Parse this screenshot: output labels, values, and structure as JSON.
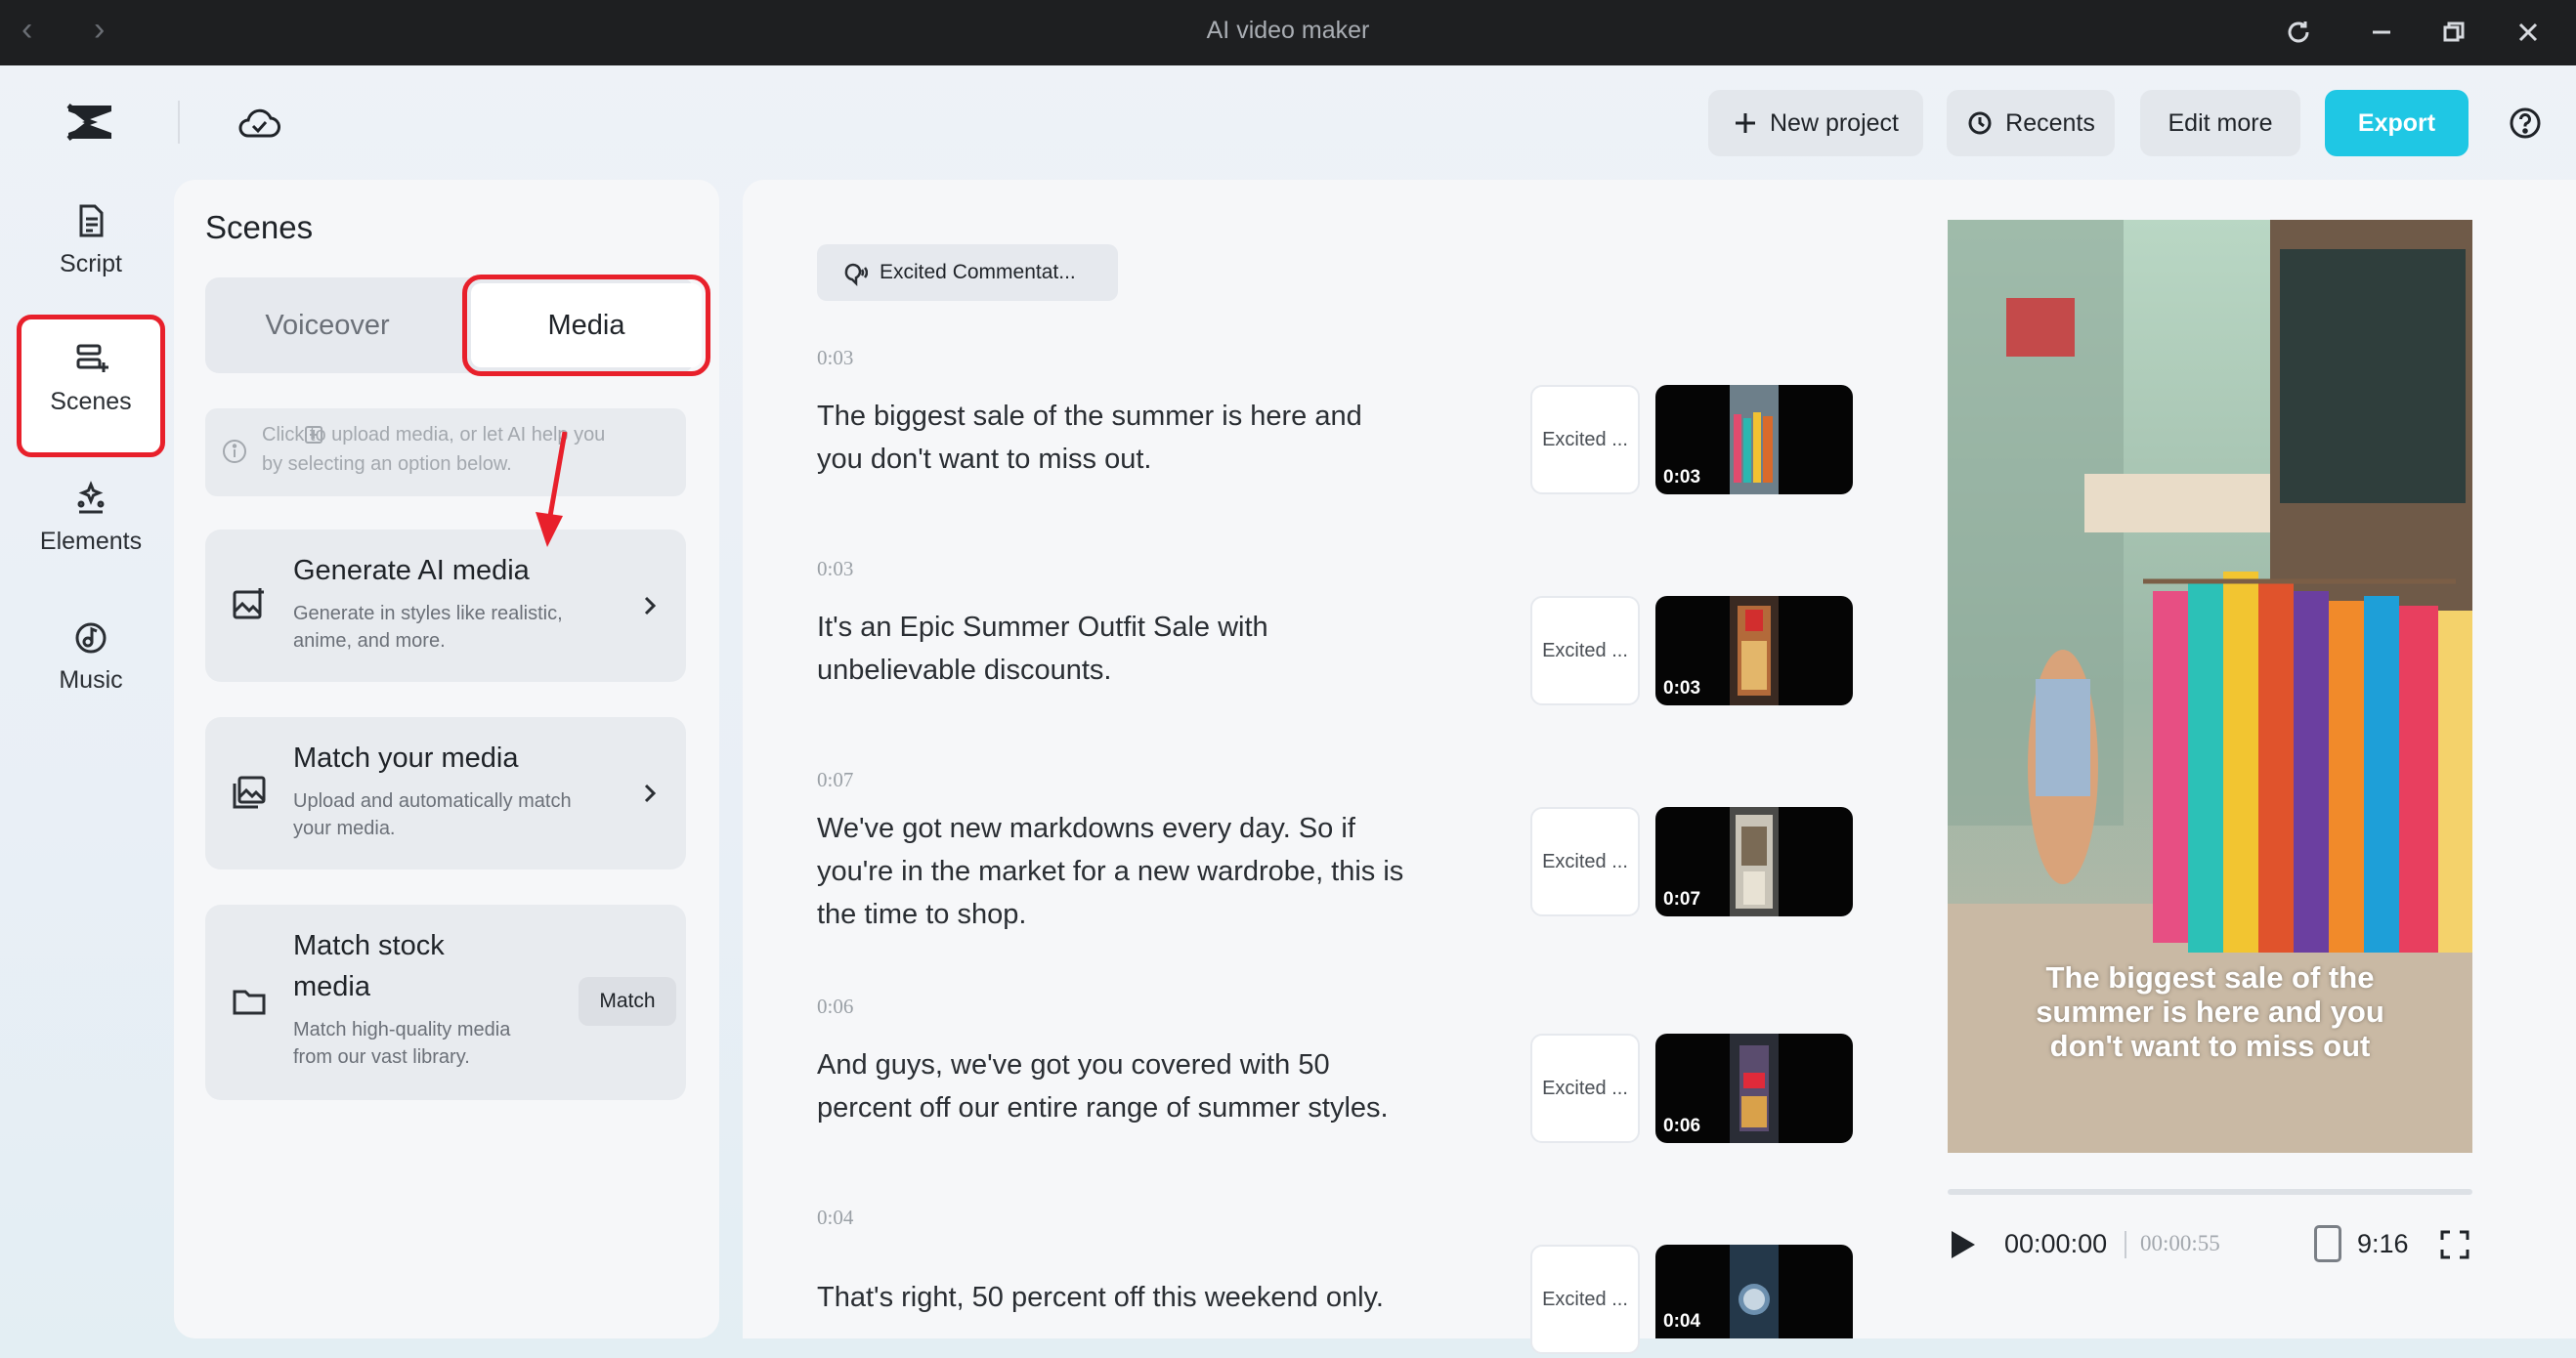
{
  "window": {
    "title": "AI video maker",
    "back_glyph": "‹",
    "forward_glyph": "›"
  },
  "header": {
    "new_project_label": "New project",
    "recents_label": "Recents",
    "edit_more_label": "Edit more",
    "export_label": "Export"
  },
  "rail": {
    "items": [
      {
        "label": "Script",
        "icon": "script-icon"
      },
      {
        "label": "Scenes",
        "icon": "scenes-icon",
        "active": true
      },
      {
        "label": "Elements",
        "icon": "elements-icon"
      },
      {
        "label": "Music",
        "icon": "music-icon"
      }
    ]
  },
  "scenes_panel": {
    "title": "Scenes",
    "tabs": [
      "Voiceover",
      "Media"
    ],
    "selected_tab": "Media",
    "hint_line1": "Click   to upload media, or let AI help you",
    "hint_line2": "by selecting an option below.",
    "options": [
      {
        "title": "Generate AI media",
        "desc1": "Generate in styles like realistic,",
        "desc2": "anime, and more."
      },
      {
        "title": "Match your media",
        "desc1": "Upload and automatically match",
        "desc2": "your media."
      },
      {
        "title1": "Match stock",
        "title2": "media",
        "desc1": "Match high-quality media",
        "desc2": "from our vast library.",
        "button": "Match"
      }
    ]
  },
  "main": {
    "voice_chip": "Excited Commentat...",
    "scenes": [
      {
        "time": "0:03",
        "lines": [
          "The biggest sale of the summer is here and",
          "you don't want to miss out."
        ],
        "mood": "Excited ...",
        "duration": "0:03"
      },
      {
        "time": "0:03",
        "lines": [
          "It's an Epic Summer Outfit Sale with",
          "unbelievable discounts."
        ],
        "mood": "Excited ...",
        "duration": "0:03"
      },
      {
        "time": "0:07",
        "lines": [
          "We've got new markdowns every day. So if",
          "you're in the market for a new wardrobe, this is",
          "the time to shop."
        ],
        "mood": "Excited ...",
        "duration": "0:07"
      },
      {
        "time": "0:06",
        "lines": [
          "And guys, we've got you covered with 50",
          "percent off our entire range of summer styles."
        ],
        "mood": "Excited ...",
        "duration": "0:06"
      },
      {
        "time": "0:04",
        "lines": [
          "That's right, 50 percent off this weekend only."
        ],
        "mood": "Excited ...",
        "duration": "0:04"
      }
    ]
  },
  "preview": {
    "caption_lines": [
      "The biggest sale of the",
      "summer is here and you",
      "don't want to miss out"
    ],
    "current_time": "00:00:00",
    "total_time": "00:00:55",
    "aspect_ratio": "9:16",
    "progress": 0
  },
  "colors": {
    "accent": "#1fc7e4",
    "highlight_red": "#e8202b"
  }
}
